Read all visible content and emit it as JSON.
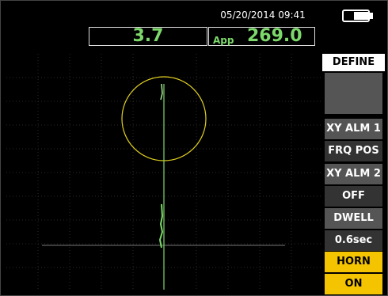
{
  "status": {
    "datetime": "05/20/2014  09:41",
    "battery_icon": "battery-icon"
  },
  "readouts": {
    "left_value": "3.7",
    "right_label": "App",
    "right_value": "269.0",
    "value_color": "#7dd86b"
  },
  "menu": {
    "title": "DEFINE",
    "items": [
      {
        "name": "XY ALM 1",
        "value": "FRQ POS"
      },
      {
        "name": "XY ALM 2",
        "value": "OFF"
      },
      {
        "name": "DWELL",
        "value": "0.6sec"
      },
      {
        "name": "HORN",
        "value": "ON"
      }
    ],
    "active_color": "#f4c400"
  },
  "display": {
    "alarm_circle_color": "#e0d020",
    "trace_color": "#7dd86b"
  }
}
